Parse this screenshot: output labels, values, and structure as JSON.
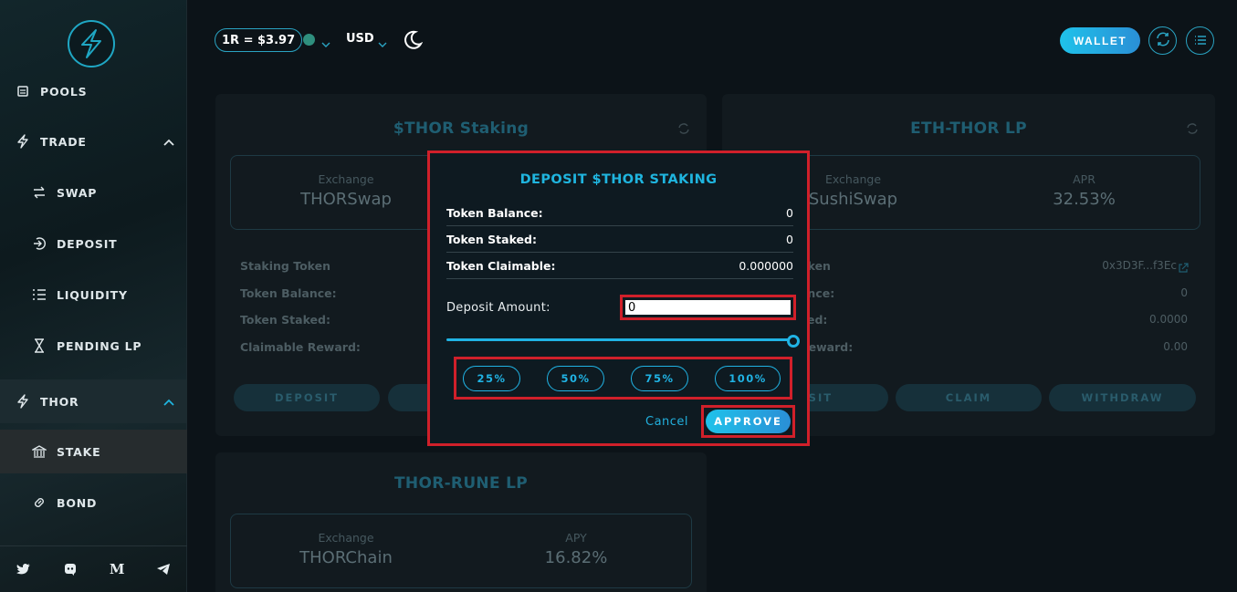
{
  "header": {
    "price": "1R = $3.97",
    "currency": "USD",
    "wallet_label": "WALLET"
  },
  "sidebar": {
    "items": [
      {
        "label": "POOLS",
        "icon": "pools-icon"
      },
      {
        "label": "TRADE",
        "icon": "lightning-icon"
      },
      {
        "label": "SWAP",
        "icon": "swap-icon"
      },
      {
        "label": "DEPOSIT",
        "icon": "deposit-icon"
      },
      {
        "label": "LIQUIDITY",
        "icon": "list-icon"
      },
      {
        "label": "PENDING LP",
        "icon": "hourglass-icon"
      },
      {
        "label": "THOR",
        "icon": "lightning-icon"
      },
      {
        "label": "STAKE",
        "icon": "bank-icon"
      },
      {
        "label": "BOND",
        "icon": "link-icon"
      }
    ],
    "social": [
      "twitter-icon",
      "discord-icon",
      "medium-icon",
      "telegram-icon"
    ],
    "medium_letter": "M"
  },
  "cards": {
    "thor_staking": {
      "title": "$THOR Staking",
      "exchange_label": "Exchange",
      "exchange_value": "THORSwap",
      "rows": [
        "Staking Token",
        "Token Balance:",
        "Token Staked:",
        "Claimable Reward:"
      ],
      "deposit_label": "DEPOSIT"
    },
    "eth_thor_lp": {
      "title": "ETH-THOR LP",
      "exchange_label": "Exchange",
      "exchange_value": "SushiSwap",
      "apr_label": "APR",
      "apr_value": "32.53%",
      "rows": [
        "oken",
        "ance:",
        "ked:",
        "Reward:"
      ],
      "values": [
        "0x3D3F...f3Ec",
        "0",
        "0.0000",
        "0.00"
      ],
      "deposit_label": "OSIT",
      "claim_label": "CLAIM",
      "withdraw_label": "WITHDRAW"
    },
    "thor_rune_lp": {
      "title": "THOR-RUNE LP",
      "exchange_label": "Exchange",
      "exchange_value": "THORChain",
      "apy_label": "APY",
      "apy_value": "16.82%"
    }
  },
  "modal": {
    "title": "DEPOSIT $THOR STAKING",
    "rows": [
      {
        "label": "Token Balance:",
        "value": "0"
      },
      {
        "label": "Token Staked:",
        "value": "0"
      },
      {
        "label": "Token Claimable:",
        "value": "0.000000"
      }
    ],
    "deposit_amount_label": "Deposit Amount:",
    "deposit_amount_value": "0",
    "slider_value": 1.0,
    "percent_buttons": [
      "25%",
      "50%",
      "75%",
      "100%"
    ],
    "cancel_label": "Cancel",
    "approve_label": "APPROVE"
  },
  "colors": {
    "accent": "#1fb5df",
    "highlight_box": "#d0202a",
    "network_dot": "#2f8f7e"
  }
}
